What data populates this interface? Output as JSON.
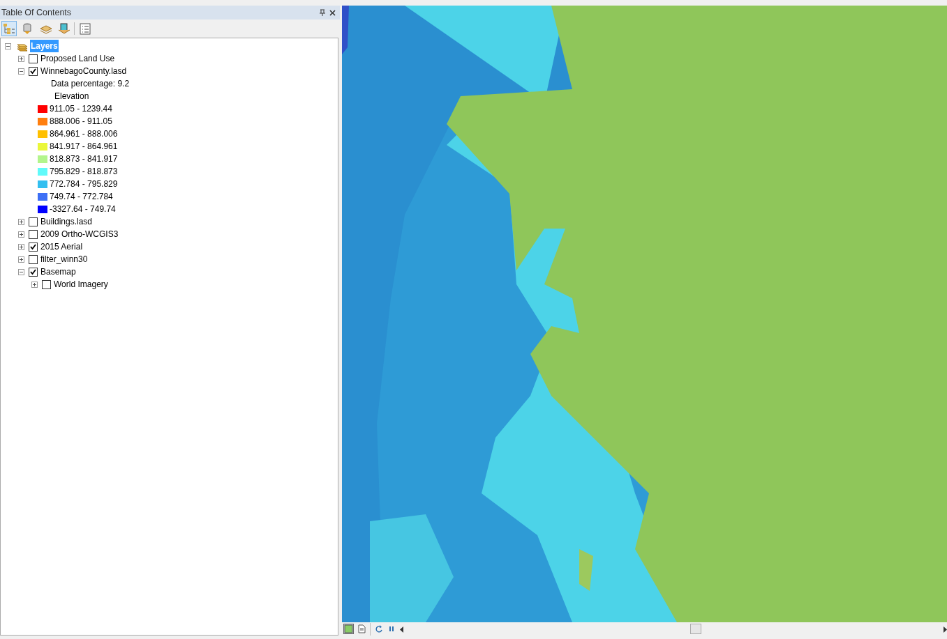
{
  "panel": {
    "title": "Table Of Contents"
  },
  "toolbar_buttons": [
    {
      "kind": "list-by-drawing",
      "selected": true
    },
    {
      "kind": "list-by-source",
      "selected": false
    },
    {
      "kind": "list-by-visibility",
      "selected": false
    },
    {
      "kind": "list-by-selection",
      "selected": false
    },
    {
      "kind": "options",
      "selected": false
    }
  ],
  "tree": {
    "label": "Layers",
    "expanded": true,
    "selected": true,
    "children": [
      {
        "label": "Proposed Land Use",
        "expanded": false,
        "checked": false
      },
      {
        "label": "WinnebagoCounty.lasd",
        "expanded": true,
        "checked": true,
        "detail": "Data percentage: 9.2",
        "legend": {
          "heading": "Elevation",
          "classes": [
            {
              "label": "911.05 - 1239.44",
              "color": "#ff0000"
            },
            {
              "label": "888.006 - 911.05",
              "color": "#ff7f0f"
            },
            {
              "label": "864.961 - 888.006",
              "color": "#ffc000"
            },
            {
              "label": "841.917 - 864.961",
              "color": "#eaf73a"
            },
            {
              "label": "818.873 - 841.917",
              "color": "#b3f58c"
            },
            {
              "label": "795.829 - 818.873",
              "color": "#60fafa"
            },
            {
              "label": "772.784 - 795.829",
              "color": "#33bff0"
            },
            {
              "label": "749.74 - 772.784",
              "color": "#3d6ff5"
            },
            {
              "label": "-3327.64 - 749.74",
              "color": "#0000ff"
            }
          ]
        }
      },
      {
        "label": "Buildings.lasd",
        "expanded": false,
        "checked": false
      },
      {
        "label": "2009 Ortho-WCGIS3",
        "expanded": false,
        "checked": false
      },
      {
        "label": "2015 Aerial",
        "expanded": false,
        "checked": true
      },
      {
        "label": "filter_winn30",
        "expanded": false,
        "checked": false
      },
      {
        "label": "Basemap",
        "expanded": true,
        "checked": true,
        "children": [
          {
            "label": "World Imagery",
            "expanded": false,
            "checked": false
          }
        ]
      }
    ]
  },
  "map_view": {
    "buttons": [
      {
        "kind": "data-view",
        "selected": true
      },
      {
        "kind": "layout-view",
        "selected": false
      },
      {
        "kind": "refresh",
        "selected": false
      },
      {
        "kind": "pause",
        "selected": false
      }
    ]
  }
}
